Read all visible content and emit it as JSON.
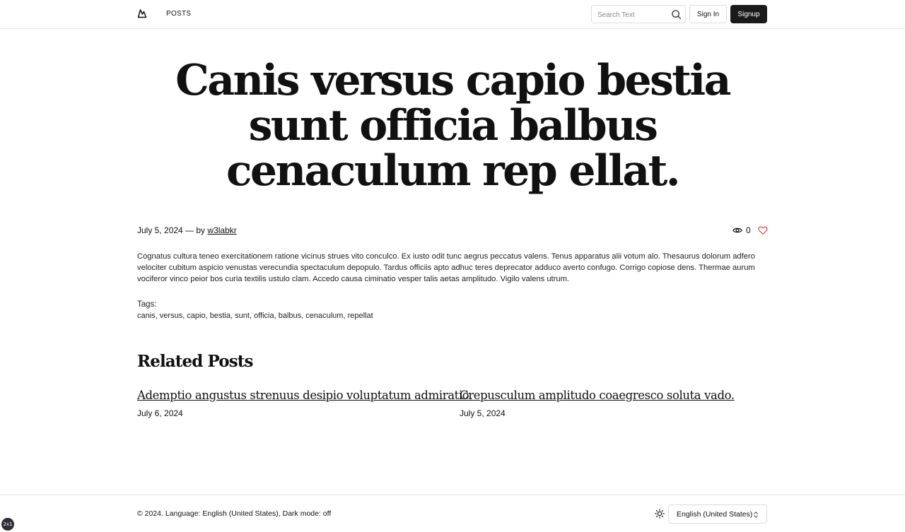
{
  "header": {
    "logo_icon": "mountain-logo-icon",
    "nav_posts": "POSTS",
    "search": {
      "placeholder": "Search Text",
      "value": "",
      "icon": "search-icon"
    },
    "sign_in_label": "Sign In",
    "sign_up_label": "Signup"
  },
  "post": {
    "title": "Canis versus capio bestia sunt officia balbus cenaculum rep ellat.",
    "date": "July 5, 2024",
    "by_text": " — by ",
    "author": "w3labkr",
    "view_count": "0",
    "body": "Cognatus cultura teneo exercitationem ratione vicinus strues vito conculco. Ex iusto odit tunc aegrus peccatus valens. Tenus apparatus alii votum alo. Thesaurus dolorum adfero velociter cubitum aspicio venustas verecundia spectaculum depopulo. Tardus officiis apto adhuc teres deprecator adduco averto confugo. Corrigo copiose dens. Thermae aurum vociferor vinco peior bos curia textilis ustulo clam. Accedo causa ciminatio vesper talis aetas amplitudo. Vigilo valens utrum.",
    "tags_label": "Tags:",
    "tags": "canis, versus, capio, bestia, sunt, officia, balbus, cenaculum, repellat"
  },
  "related": {
    "heading": "Related Posts",
    "items": [
      {
        "title": "Ademptio angustus strenuus desipio voluptatum admiratio.",
        "date": "July 6, 2024"
      },
      {
        "title": "Crepusculum amplitudo coaegresco soluta vado.",
        "date": "July 5, 2024"
      }
    ]
  },
  "footer": {
    "copyright": "© 2024. Language: English (United States), Dark mode: off",
    "theme_icon": "sun-icon",
    "language_value": "English (United States)"
  },
  "badge": "2x1",
  "colors": {
    "primary_button": "#1a1a1a",
    "heart": "#e5484d",
    "border": "#e5e5e5"
  }
}
